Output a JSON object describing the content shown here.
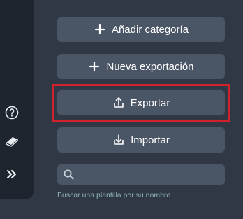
{
  "buttons": {
    "add_category": "Añadir categoría",
    "new_export": "Nueva exportación",
    "export": "Exportar",
    "import": "Importar"
  },
  "search": {
    "value": "",
    "placeholder": "",
    "hint": "Buscar una plantilla por su nombre"
  },
  "sidebar": {
    "icons": [
      "help-icon",
      "book-icon",
      "double-chevron-right-icon"
    ]
  },
  "colors": {
    "background": "#2f3844",
    "rail": "#1e252e",
    "button": "#4a5566",
    "highlight": "#d0222a",
    "hint_text": "#8fb0bd"
  }
}
